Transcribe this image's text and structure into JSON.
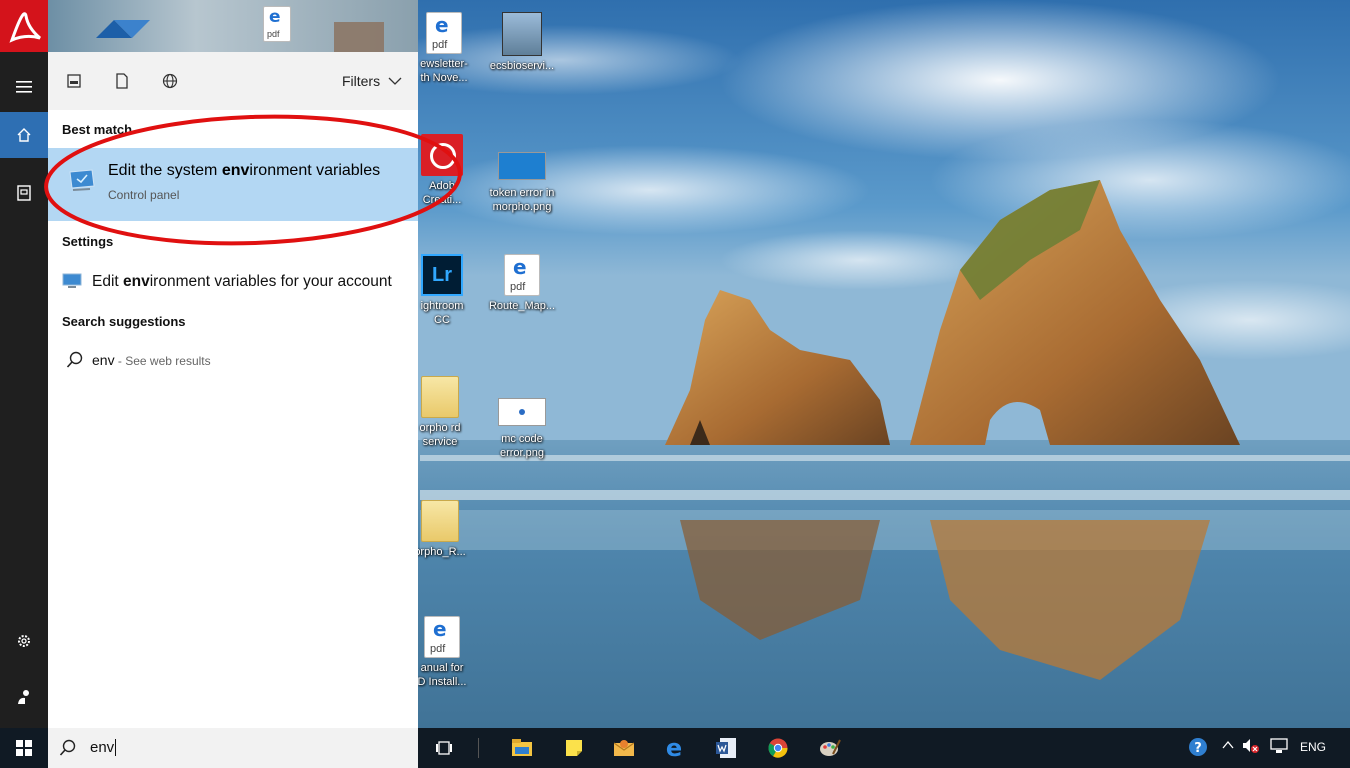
{
  "desktop": {
    "icons_col1": [
      {
        "label": "ewsletter-\nth Nove...",
        "type": "pdf"
      },
      {
        "label": "Adob\nCreati...",
        "type": "adobe"
      },
      {
        "label": "ightroom\nCC",
        "type": "lightroom"
      },
      {
        "label": "orpho rd\nservice",
        "type": "folder"
      },
      {
        "label": "orpho_R...",
        "type": "folder"
      },
      {
        "label": "anual for\nD Install...",
        "type": "pdf"
      }
    ],
    "icons_col2": [
      {
        "label": "ecsbioservi...",
        "type": "installer"
      },
      {
        "label": "token error in\nmorpho.png",
        "type": "image"
      },
      {
        "label": "Route_Map...",
        "type": "pdf"
      },
      {
        "label": "mc code\nerror.png",
        "type": "image"
      }
    ],
    "pdf_icon_text": "pdf",
    "edge_letter": "e",
    "lightroom_text": "Lr"
  },
  "search_panel": {
    "filters_label": "Filters",
    "filter_icons": [
      "apps-icon",
      "document-icon",
      "web-icon"
    ],
    "best_match_heading": "Best match",
    "best_match": {
      "title_pre": "Edit the system ",
      "title_bold": "env",
      "title_post": "ironment variables",
      "subtitle": "Control panel"
    },
    "settings_heading": "Settings",
    "settings_item": {
      "title_pre": "Edit ",
      "title_bold": "env",
      "title_post": "ironment variables for your account"
    },
    "suggestions_heading": "Search suggestions",
    "suggestion": {
      "query": "env",
      "hint": " - See web results"
    }
  },
  "rail": {
    "items": [
      "hamburger-icon",
      "home-icon",
      "notebook-icon",
      "settings-icon",
      "feedback-icon"
    ]
  },
  "taskbar": {
    "search_text": "env",
    "apps": [
      "task-view-icon",
      "file-explorer-icon",
      "sticky-notes-icon",
      "outlook-icon",
      "edge-icon",
      "word-icon",
      "chrome-icon",
      "paint-icon"
    ],
    "tray_language": "ENG"
  },
  "colors": {
    "rail": "#1f1f1f",
    "accent": "#2e6fb3",
    "highlight": "#b3d7f3",
    "taskbar": "#101a24",
    "annotation": "#e01010"
  }
}
